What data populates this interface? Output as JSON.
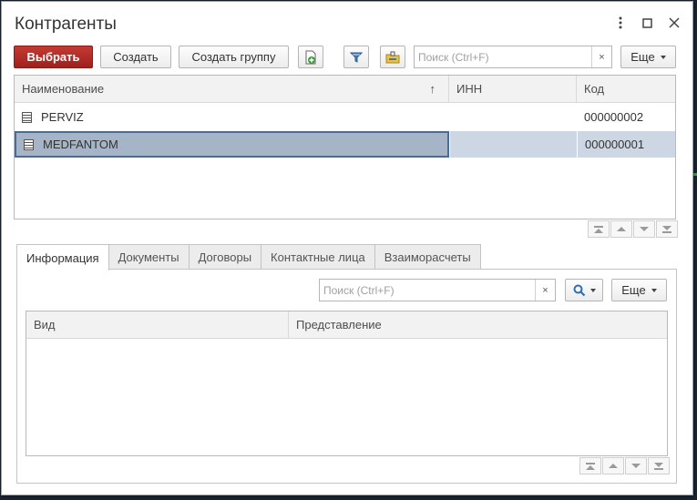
{
  "window": {
    "title": "Контрагенты",
    "menu_icon": "more-vertical-icon",
    "maximize_icon": "maximize-icon",
    "close_icon": "close-icon"
  },
  "toolbar": {
    "select_label": "Выбрать",
    "create_label": "Создать",
    "create_group_label": "Создать группу",
    "copy_icon": "add-copy-icon",
    "filter_icon": "filter-icon",
    "folder_icon": "folder-move-icon",
    "search_placeholder": "Поиск (Ctrl+F)",
    "search_clear": "×",
    "more_label": "Еще"
  },
  "list": {
    "columns": {
      "name": "Наименование",
      "sort_arrow": "↑",
      "inn": "ИНН",
      "code": "Код"
    },
    "rows": [
      {
        "name": "PERVIZ",
        "inn": "",
        "code": "000000002",
        "selected": false
      },
      {
        "name": "MEDFANTOM",
        "inn": "",
        "code": "000000001",
        "selected": true
      }
    ]
  },
  "tabs": [
    {
      "label": "Информация",
      "active": true
    },
    {
      "label": "Документы",
      "active": false
    },
    {
      "label": "Договоры",
      "active": false
    },
    {
      "label": "Контактные лица",
      "active": false
    },
    {
      "label": "Взаиморасчеты",
      "active": false
    }
  ],
  "info_panel": {
    "search_placeholder": "Поиск (Ctrl+F)",
    "search_clear": "×",
    "search_icon": "search-icon",
    "more_label": "Еще",
    "columns": {
      "kind": "Вид",
      "representation": "Представление"
    }
  },
  "colors": {
    "primary_button": "#b02a25",
    "selected_row": "#cdd7e3",
    "selected_cell": "#a5b4c6"
  }
}
